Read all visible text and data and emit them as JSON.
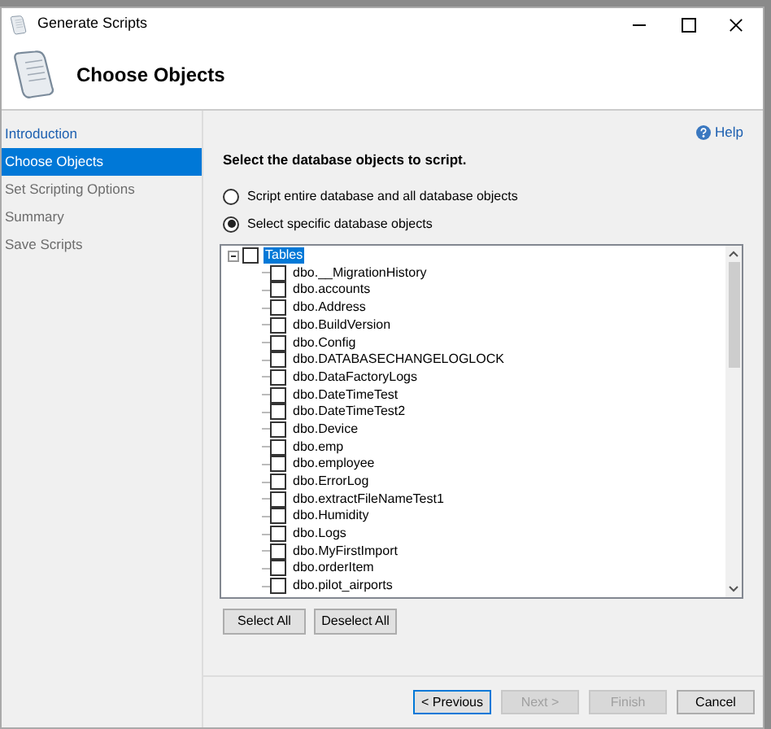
{
  "window": {
    "title": "Generate Scripts"
  },
  "header": {
    "title": "Choose Objects"
  },
  "nav": [
    {
      "label": "Introduction",
      "selected": false,
      "disabled": false
    },
    {
      "label": "Choose Objects",
      "selected": true,
      "disabled": false
    },
    {
      "label": "Set Scripting Options",
      "selected": false,
      "disabled": true
    },
    {
      "label": "Summary",
      "selected": false,
      "disabled": true
    },
    {
      "label": "Save Scripts",
      "selected": false,
      "disabled": true
    }
  ],
  "help": "Help",
  "instruction": "Select the database objects to script.",
  "options": [
    {
      "label": "Script entire database and all database objects",
      "selected": false
    },
    {
      "label": "Select specific database objects",
      "selected": true
    }
  ],
  "tree": {
    "label": "Tables",
    "checked": false,
    "expanded": true,
    "children": [
      {
        "label": "dbo.__MigrationHistory",
        "checked": false
      },
      {
        "label": "dbo.accounts",
        "checked": false
      },
      {
        "label": "dbo.Address",
        "checked": false
      },
      {
        "label": "dbo.BuildVersion",
        "checked": false
      },
      {
        "label": "dbo.Config",
        "checked": false
      },
      {
        "label": "dbo.DATABASECHANGELOGLOCK",
        "checked": false
      },
      {
        "label": "dbo.DataFactoryLogs",
        "checked": false
      },
      {
        "label": "dbo.DateTimeTest",
        "checked": false
      },
      {
        "label": "dbo.DateTimeTest2",
        "checked": false
      },
      {
        "label": "dbo.Device",
        "checked": false
      },
      {
        "label": "dbo.emp",
        "checked": false
      },
      {
        "label": "dbo.employee",
        "checked": false
      },
      {
        "label": "dbo.ErrorLog",
        "checked": false
      },
      {
        "label": "dbo.extractFileNameTest1",
        "checked": false
      },
      {
        "label": "dbo.Humidity",
        "checked": false
      },
      {
        "label": "dbo.Logs",
        "checked": false
      },
      {
        "label": "dbo.MyFirstImport",
        "checked": false
      },
      {
        "label": "dbo.orderItem",
        "checked": false
      },
      {
        "label": "dbo.pilot_airports",
        "checked": false
      }
    ]
  },
  "tree_buttons": [
    "Select All",
    "Deselect All"
  ],
  "footer_buttons": [
    {
      "label": "< Previous",
      "disabled": false,
      "focused": true
    },
    {
      "label": "Next >",
      "disabled": true,
      "focused": false
    },
    {
      "label": "Finish",
      "disabled": true,
      "focused": false
    },
    {
      "label": "Cancel",
      "disabled": false,
      "focused": false
    }
  ]
}
